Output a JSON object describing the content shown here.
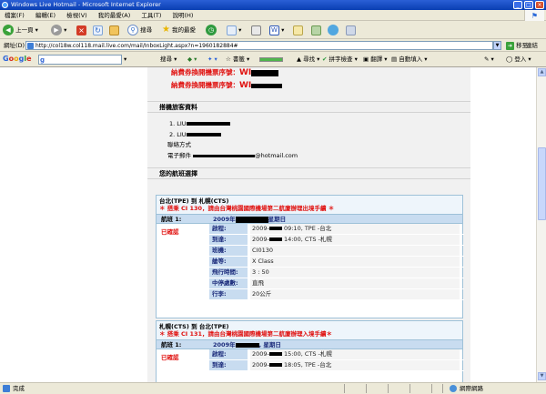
{
  "window": {
    "title": "Windows Live Hotmail - Microsoft Internet Explorer",
    "buttons": {
      "minimize": "_",
      "maximize": "□",
      "close": "×"
    }
  },
  "menu": [
    "檔案(F)",
    "編輯(E)",
    "檢視(V)",
    "我的最愛(A)",
    "工具(T)",
    "說明(H)"
  ],
  "toolbar": {
    "back": "上一頁",
    "search": "搜尋",
    "favorites": "我的最愛"
  },
  "address": {
    "label": "網址(D)",
    "url": "http://col18w.col118.mail.live.com/mail/InboxLight.aspx?n=1960182884#",
    "go": "移至",
    "links": "連結"
  },
  "google": {
    "logo": "Google",
    "search": "搜尋",
    "bookmarks": "書籤",
    "pagerank": "PageRank",
    "find": "尋找",
    "spellcheck": "拼字檢查",
    "translate": "翻譯",
    "autofill": "自動填入",
    "signin": "登入"
  },
  "ticket": {
    "line1": "納費券換開機票序號：",
    "code1": "WI",
    "line2": "納費券換開機票序號：",
    "code2": "WI"
  },
  "passenger": {
    "heading": "搭機旅客資料",
    "items": [
      "1. LIU",
      "2. LIU"
    ],
    "contact_label": "聯絡方式",
    "email_label": "電子郵件",
    "email_suffix": "@hotmail.com"
  },
  "flights_heading": "您的航班選擇",
  "flight1": {
    "route": "台北(TPE) 到 札幌(CTS)",
    "notice": "＊ 搭乘 CI 130，請由台灣桃園國際機場第二航廈辦理出境手續 ＊",
    "seg_label": "航班 1:",
    "date_prefix": "2009年",
    "date_suffix": "星期日",
    "status": "已確認",
    "rows": [
      {
        "k": "啟程:",
        "pre": "2009-",
        "v": "09:10, TPE -台北"
      },
      {
        "k": "到達:",
        "pre": "2009-",
        "v": "14:00, CTS -札幌"
      },
      {
        "k": "班機:",
        "pre": "",
        "v": "CI0130"
      },
      {
        "k": "艙等:",
        "pre": "",
        "v": "X Class"
      },
      {
        "k": "飛行時間:",
        "pre": "",
        "v": "3 : 50"
      },
      {
        "k": "中停處數:",
        "pre": "",
        "v": "直飛"
      },
      {
        "k": "行李:",
        "pre": "",
        "v": "20公斤"
      }
    ]
  },
  "flight2": {
    "route": "札幌(CTS) 到 台北(TPE)",
    "notice": "＊ 搭乘 CI 131，請由台灣桃園國際機場第二航廈辦理入境手續＊",
    "seg_label": "航班 1:",
    "date_prefix": "2009年",
    "date_suffix": ", 星期日",
    "status": "已確認",
    "rows": [
      {
        "k": "啟程:",
        "pre": "2009-",
        "v": "15:00, CTS -札幌"
      },
      {
        "k": "到達:",
        "pre": "2009-",
        "v": "18:05, TPE -台北"
      }
    ]
  },
  "status": {
    "done": "完成",
    "zone": "網際網路"
  }
}
